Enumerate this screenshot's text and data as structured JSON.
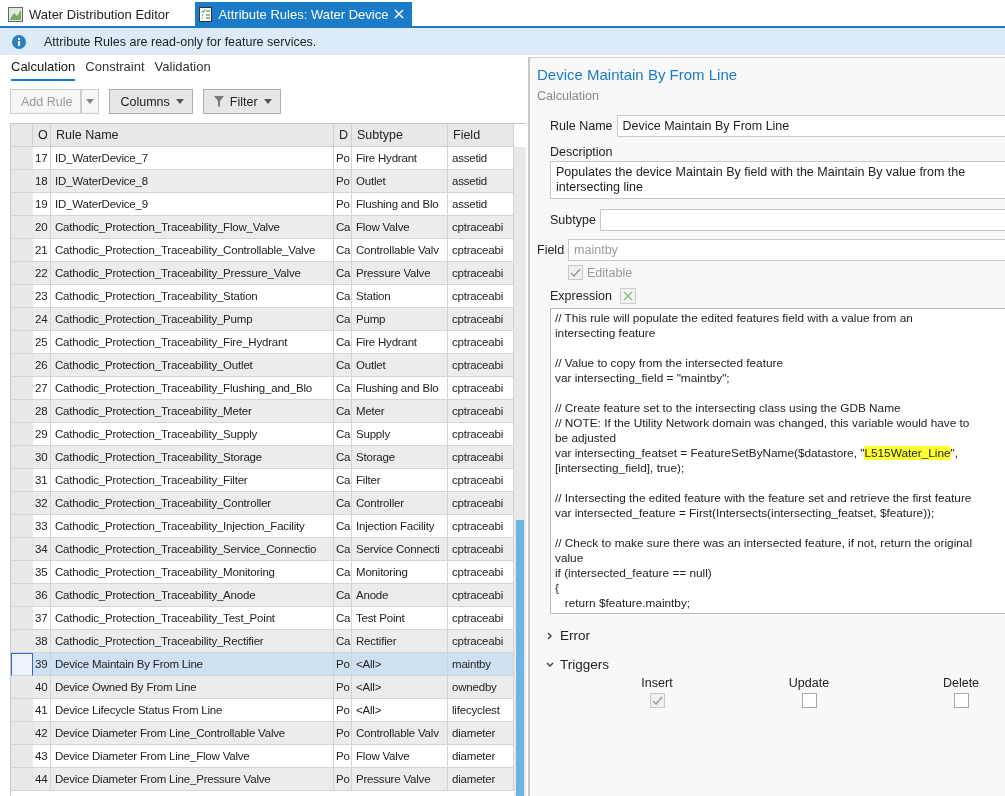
{
  "doc_tabs": [
    {
      "label": "Water Distribution Editor",
      "kind": "map",
      "selected": false
    },
    {
      "label": "Attribute Rules: Water Device",
      "kind": "rules",
      "selected": true
    }
  ],
  "info_bar": {
    "message": "Attribute Rules are read-only for feature services."
  },
  "rule_tabs": [
    {
      "label": "Calculation",
      "selected": true
    },
    {
      "label": "Constraint",
      "selected": false
    },
    {
      "label": "Validation",
      "selected": false
    }
  ],
  "toolbar": {
    "add_rule": {
      "label": "Add Rule",
      "disabled": true
    },
    "columns": {
      "label": "Columns"
    },
    "filter": {
      "label": "Filter"
    }
  },
  "table": {
    "columns": [
      "O",
      "Rule Name",
      "D",
      "Subtype",
      "Field"
    ],
    "rows": [
      {
        "order": "17",
        "name": "ID_WaterDevice_7",
        "d": "Po",
        "subtype": "Fire Hydrant",
        "field": "assetid",
        "selected": false
      },
      {
        "order": "18",
        "name": "ID_WaterDevice_8",
        "d": "Po",
        "subtype": "Outlet",
        "field": "assetid",
        "selected": false
      },
      {
        "order": "19",
        "name": "ID_WaterDevice_9",
        "d": "Po",
        "subtype": "Flushing and Blo",
        "field": "assetid",
        "selected": false
      },
      {
        "order": "20",
        "name": "Cathodic_Protection_Traceability_Flow_Valve",
        "d": "Ca",
        "subtype": "Flow Valve",
        "field": "cptraceabi",
        "selected": false
      },
      {
        "order": "21",
        "name": "Cathodic_Protection_Traceability_Controllable_Valve",
        "d": "Ca",
        "subtype": "Controllable Valv",
        "field": "cptraceabi",
        "selected": false
      },
      {
        "order": "22",
        "name": "Cathodic_Protection_Traceability_Pressure_Valve",
        "d": "Ca",
        "subtype": "Pressure Valve",
        "field": "cptraceabi",
        "selected": false
      },
      {
        "order": "23",
        "name": "Cathodic_Protection_Traceability_Station",
        "d": "Ca",
        "subtype": "Station",
        "field": "cptraceabi",
        "selected": false
      },
      {
        "order": "24",
        "name": "Cathodic_Protection_Traceability_Pump",
        "d": "Ca",
        "subtype": "Pump",
        "field": "cptraceabi",
        "selected": false
      },
      {
        "order": "25",
        "name": "Cathodic_Protection_Traceability_Fire_Hydrant",
        "d": "Ca",
        "subtype": "Fire Hydrant",
        "field": "cptraceabi",
        "selected": false
      },
      {
        "order": "26",
        "name": "Cathodic_Protection_Traceability_Outlet",
        "d": "Ca",
        "subtype": "Outlet",
        "field": "cptraceabi",
        "selected": false
      },
      {
        "order": "27",
        "name": "Cathodic_Protection_Traceability_Flushing_and_Blo",
        "d": "Ca",
        "subtype": "Flushing and Blo",
        "field": "cptraceabi",
        "selected": false
      },
      {
        "order": "28",
        "name": "Cathodic_Protection_Traceability_Meter",
        "d": "Ca",
        "subtype": "Meter",
        "field": "cptraceabi",
        "selected": false
      },
      {
        "order": "29",
        "name": "Cathodic_Protection_Traceability_Supply",
        "d": "Ca",
        "subtype": "Supply",
        "field": "cptraceabi",
        "selected": false
      },
      {
        "order": "30",
        "name": "Cathodic_Protection_Traceability_Storage",
        "d": "Ca",
        "subtype": "Storage",
        "field": "cptraceabi",
        "selected": false
      },
      {
        "order": "31",
        "name": "Cathodic_Protection_Traceability_Filter",
        "d": "Ca",
        "subtype": "Filter",
        "field": "cptraceabi",
        "selected": false
      },
      {
        "order": "32",
        "name": "Cathodic_Protection_Traceability_Controller",
        "d": "Ca",
        "subtype": "Controller",
        "field": "cptraceabi",
        "selected": false
      },
      {
        "order": "33",
        "name": "Cathodic_Protection_Traceability_Injection_Facility",
        "d": "Ca",
        "subtype": "Injection Facility",
        "field": "cptraceabi",
        "selected": false
      },
      {
        "order": "34",
        "name": "Cathodic_Protection_Traceability_Service_Connectio",
        "d": "Ca",
        "subtype": "Service Connecti",
        "field": "cptraceabi",
        "selected": false
      },
      {
        "order": "35",
        "name": "Cathodic_Protection_Traceability_Monitoring",
        "d": "Ca",
        "subtype": "Monitoring",
        "field": "cptraceabi",
        "selected": false
      },
      {
        "order": "36",
        "name": "Cathodic_Protection_Traceability_Anode",
        "d": "Ca",
        "subtype": "Anode",
        "field": "cptraceabi",
        "selected": false
      },
      {
        "order": "37",
        "name": "Cathodic_Protection_Traceability_Test_Point",
        "d": "Ca",
        "subtype": "Test Point",
        "field": "cptraceabi",
        "selected": false
      },
      {
        "order": "38",
        "name": "Cathodic_Protection_Traceability_Rectifier",
        "d": "Ca",
        "subtype": "Rectifier",
        "field": "cptraceabi",
        "selected": false
      },
      {
        "order": "39",
        "name": "Device Maintain By From Line",
        "d": "Po",
        "subtype": "<All>",
        "field": "maintby",
        "selected": true
      },
      {
        "order": "40",
        "name": "Device Owned By From Line",
        "d": "Po",
        "subtype": "<All>",
        "field": "ownedby",
        "selected": false
      },
      {
        "order": "41",
        "name": "Device Lifecycle Status From Line",
        "d": "Po",
        "subtype": "<All>",
        "field": "lifecyclest",
        "selected": false
      },
      {
        "order": "42",
        "name": "Device Diameter From Line_Controllable Valve",
        "d": "Po",
        "subtype": "Controllable Valv",
        "field": "diameter",
        "selected": false
      },
      {
        "order": "43",
        "name": "Device Diameter From Line_Flow Valve",
        "d": "Po",
        "subtype": "Flow Valve",
        "field": "diameter",
        "selected": false
      },
      {
        "order": "44",
        "name": "Device Diameter From Line_Pressure Valve",
        "d": "Po",
        "subtype": "Pressure Valve",
        "field": "diameter",
        "selected": false
      }
    ]
  },
  "details": {
    "title": "Device Maintain By From Line",
    "rule_type": "Calculation",
    "rule_name": {
      "label": "Rule Name",
      "value": "Device Maintain By From Line"
    },
    "description": {
      "label": "Description",
      "value": "Populates the device Maintain By field with the Maintain By value from the intersecting line"
    },
    "subtype": {
      "label": "Subtype"
    },
    "field": {
      "label": "Field",
      "value": "maintby",
      "disabled": true
    },
    "editable": {
      "label": "Editable",
      "checked": true,
      "disabled": true
    },
    "expression": {
      "label": "Expression",
      "blocks": [
        [
          [
            {
              "text": "// This rule will populate the edited features field with a value from an"
            }
          ],
          [
            {
              "text": "intersecting feature"
            }
          ]
        ],
        [
          [
            {
              "text": "// Value to copy from the intersected feature"
            }
          ],
          [
            {
              "text": "var intersecting_field = \"maintby\";"
            }
          ]
        ],
        [
          [
            {
              "text": "// Create feature set to the intersecting class using the GDB Name"
            }
          ],
          [
            {
              "text": "// NOTE: If the Utility Network domain was changed, this variable would have to"
            }
          ],
          [
            {
              "text": "be adjusted"
            }
          ],
          [
            {
              "text": "var intersecting_featset = FeatureSetByName($datastore, \""
            },
            {
              "text": "L515Water_Line",
              "highlighted": true
            },
            {
              "text": "\","
            }
          ],
          [
            {
              "text": "[intersecting_field], true);"
            }
          ]
        ],
        [
          [
            {
              "text": "// Intersecting the edited feature with the feature set and retrieve the first feature"
            }
          ],
          [
            {
              "text": "var intersected_feature = First(Intersects(intersecting_featset, $feature));"
            }
          ]
        ],
        [
          [
            {
              "text": "// Check to make sure there was an intersected feature, if not, return the original"
            }
          ],
          [
            {
              "text": "value"
            }
          ],
          [
            {
              "text": "if (intersected_feature == null)"
            }
          ],
          [
            {
              "text": "{"
            }
          ],
          [
            {
              "text": "   return $feature.maintby;"
            }
          ]
        ]
      ]
    },
    "sections": [
      {
        "label": "Error",
        "expanded": false
      },
      {
        "label": "Triggers",
        "expanded": true
      }
    ],
    "triggers": [
      {
        "label": "Insert",
        "checked": true,
        "disabled": true
      },
      {
        "label": "Update",
        "checked": false,
        "disabled": false
      },
      {
        "label": "Delete",
        "checked": false,
        "disabled": false
      }
    ]
  }
}
